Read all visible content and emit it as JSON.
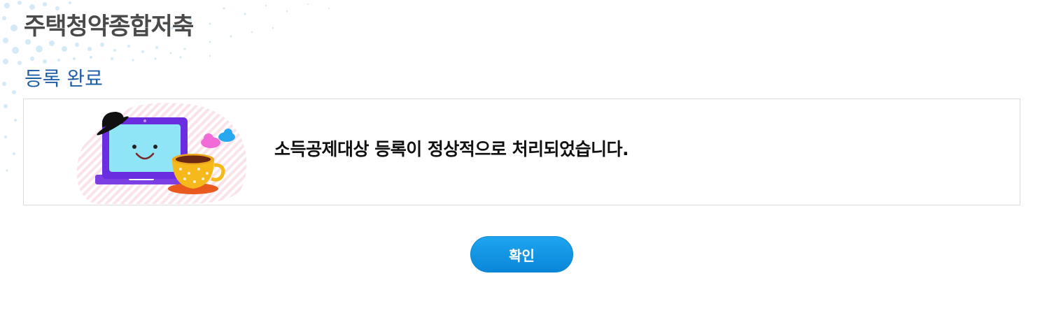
{
  "header": {
    "title": "주택청약종합저축"
  },
  "section": {
    "title": "등록 완료"
  },
  "result": {
    "message": "소득공제대상 등록이 정상적으로 처리되었습니다.",
    "illustration_icon": "laptop-coffee-illustration-icon"
  },
  "actions": {
    "confirm_label": "확인"
  },
  "colors": {
    "title_text": "#4a4a4a",
    "section_title": "#1f5fa8",
    "button_bg": "#0a8fdf",
    "box_border": "#dcdcdc"
  }
}
